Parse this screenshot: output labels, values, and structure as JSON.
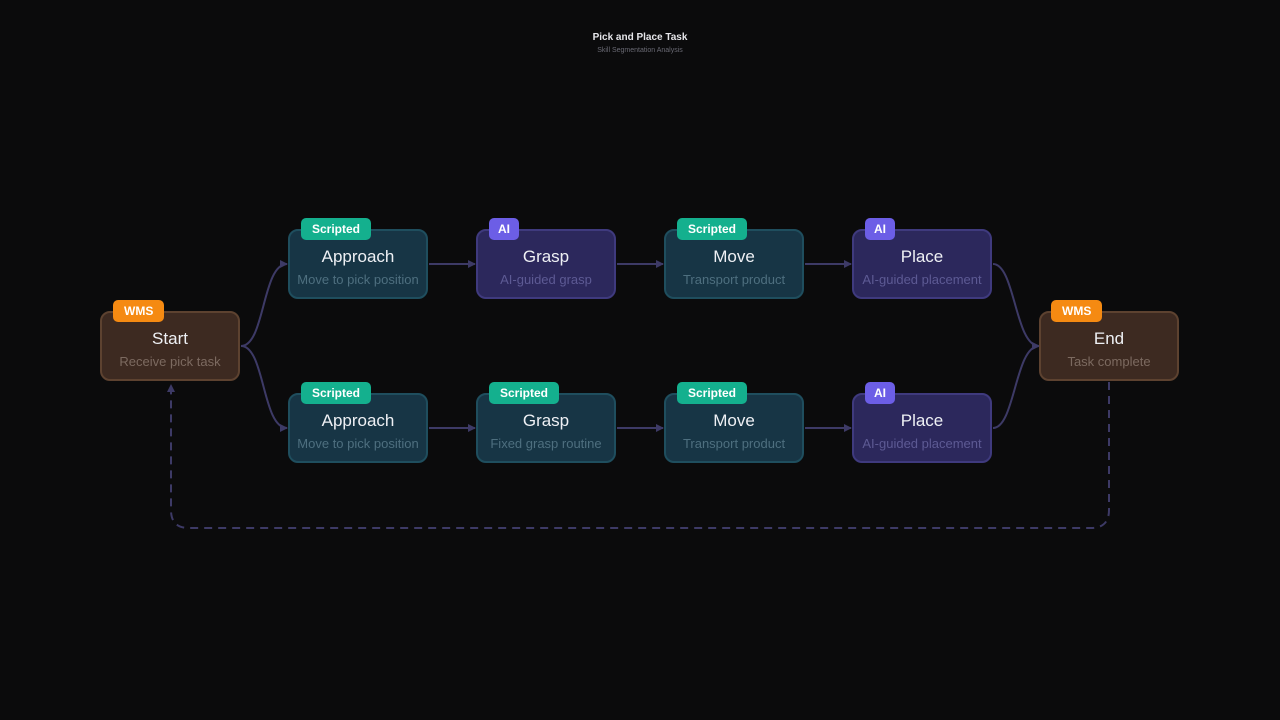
{
  "header": {
    "title": "Pick and Place Task",
    "subtitle": "Skill Segmentation Analysis"
  },
  "colors": {
    "wms_badge": "#f58a12",
    "scripted_badge": "#14b08e",
    "ai_badge": "#6c5ee6",
    "edge": "#3d3a66",
    "background": "#0b0b0c"
  },
  "nodes": {
    "start": {
      "badge": "WMS",
      "name": "Start",
      "desc": "Receive pick task"
    },
    "end": {
      "badge": "WMS",
      "name": "End",
      "desc": "Task complete"
    },
    "top": [
      {
        "badge": "Scripted",
        "name": "Approach",
        "desc": "Move to pick position"
      },
      {
        "badge": "AI",
        "name": "Grasp",
        "desc": "AI-guided grasp"
      },
      {
        "badge": "Scripted",
        "name": "Move",
        "desc": "Transport product"
      },
      {
        "badge": "AI",
        "name": "Place",
        "desc": "AI-guided placement"
      }
    ],
    "bottom": [
      {
        "badge": "Scripted",
        "name": "Approach",
        "desc": "Move to pick position"
      },
      {
        "badge": "Scripted",
        "name": "Grasp",
        "desc": "Fixed grasp routine"
      },
      {
        "badge": "Scripted",
        "name": "Move",
        "desc": "Transport product"
      },
      {
        "badge": "AI",
        "name": "Place",
        "desc": "AI-guided placement"
      }
    ]
  }
}
